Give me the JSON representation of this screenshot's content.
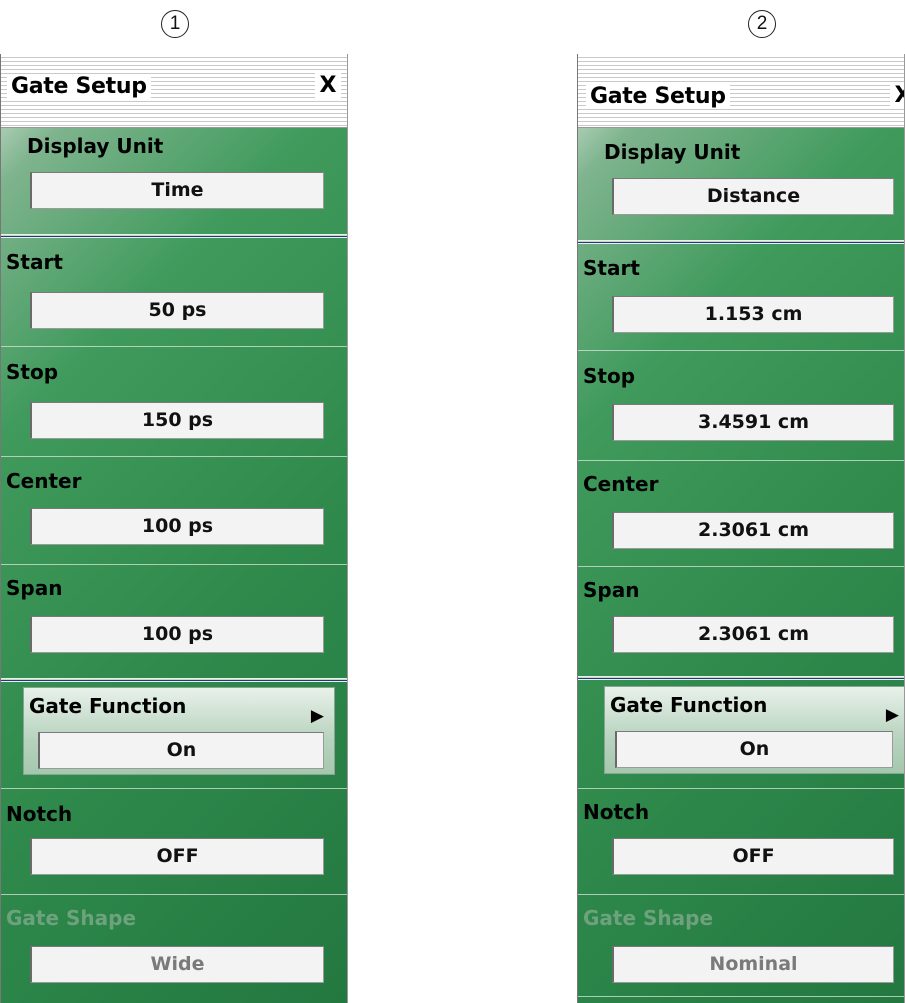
{
  "callouts": [
    "1",
    "2"
  ],
  "panels": [
    {
      "title": "Gate Setup",
      "close": "X",
      "display_unit": {
        "label": "Display Unit",
        "value": "Time"
      },
      "start": {
        "label": "Start",
        "value": "50 ps"
      },
      "stop": {
        "label": "Stop",
        "value": "150 ps"
      },
      "center": {
        "label": "Center",
        "value": "100 ps"
      },
      "span": {
        "label": "Span",
        "value": "100 ps"
      },
      "gate_function": {
        "label": "Gate Function",
        "value": "On",
        "arrow": "▶"
      },
      "notch": {
        "label": "Notch",
        "value": "OFF"
      },
      "gate_shape": {
        "label": "Gate Shape",
        "value": "Wide"
      }
    },
    {
      "title": "Gate Setup",
      "close": "X",
      "display_unit": {
        "label": "Display Unit",
        "value": "Distance"
      },
      "start": {
        "label": "Start",
        "value": "1.153 cm"
      },
      "stop": {
        "label": "Stop",
        "value": "3.4591 cm"
      },
      "center": {
        "label": "Center",
        "value": "2.3061 cm"
      },
      "span": {
        "label": "Span",
        "value": "2.3061 cm"
      },
      "gate_function": {
        "label": "Gate Function",
        "value": "On",
        "arrow": "▶"
      },
      "notch": {
        "label": "Notch",
        "value": "OFF"
      },
      "gate_shape": {
        "label": "Gate Shape",
        "value": "Nominal"
      }
    }
  ]
}
